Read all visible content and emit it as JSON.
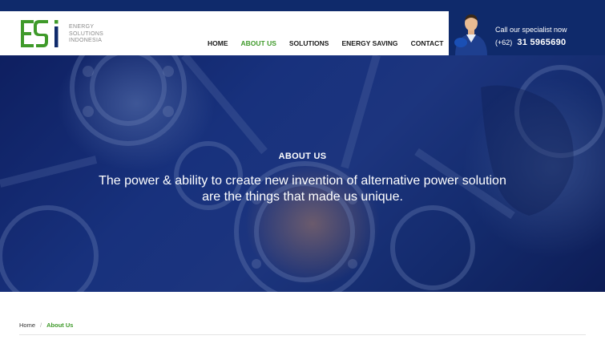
{
  "header": {
    "logo": {
      "mark": "ESI",
      "lines": [
        "ENERGY",
        "SOLUTIONS",
        "INDONESIA"
      ]
    },
    "nav": [
      {
        "label": "HOME",
        "active": false
      },
      {
        "label": "ABOUT US",
        "active": true
      },
      {
        "label": "SOLUTIONS",
        "active": false
      },
      {
        "label": "ENERGY SAVING",
        "active": false
      },
      {
        "label": "CONTACT",
        "active": false
      }
    ],
    "call": {
      "label": "Call our specialist now",
      "code": "(+62)",
      "number": "31 5965690"
    }
  },
  "hero": {
    "title": "ABOUT US",
    "text": "The power & ability to create new invention of alternative power solution are the things that made us unique."
  },
  "breadcrumb": {
    "home": "Home",
    "separator": "/",
    "current": "About Us"
  },
  "colors": {
    "brand_green": "#3f9a2a",
    "brand_blue": "#0f2a6b",
    "nav_text": "#1b1b1b"
  }
}
